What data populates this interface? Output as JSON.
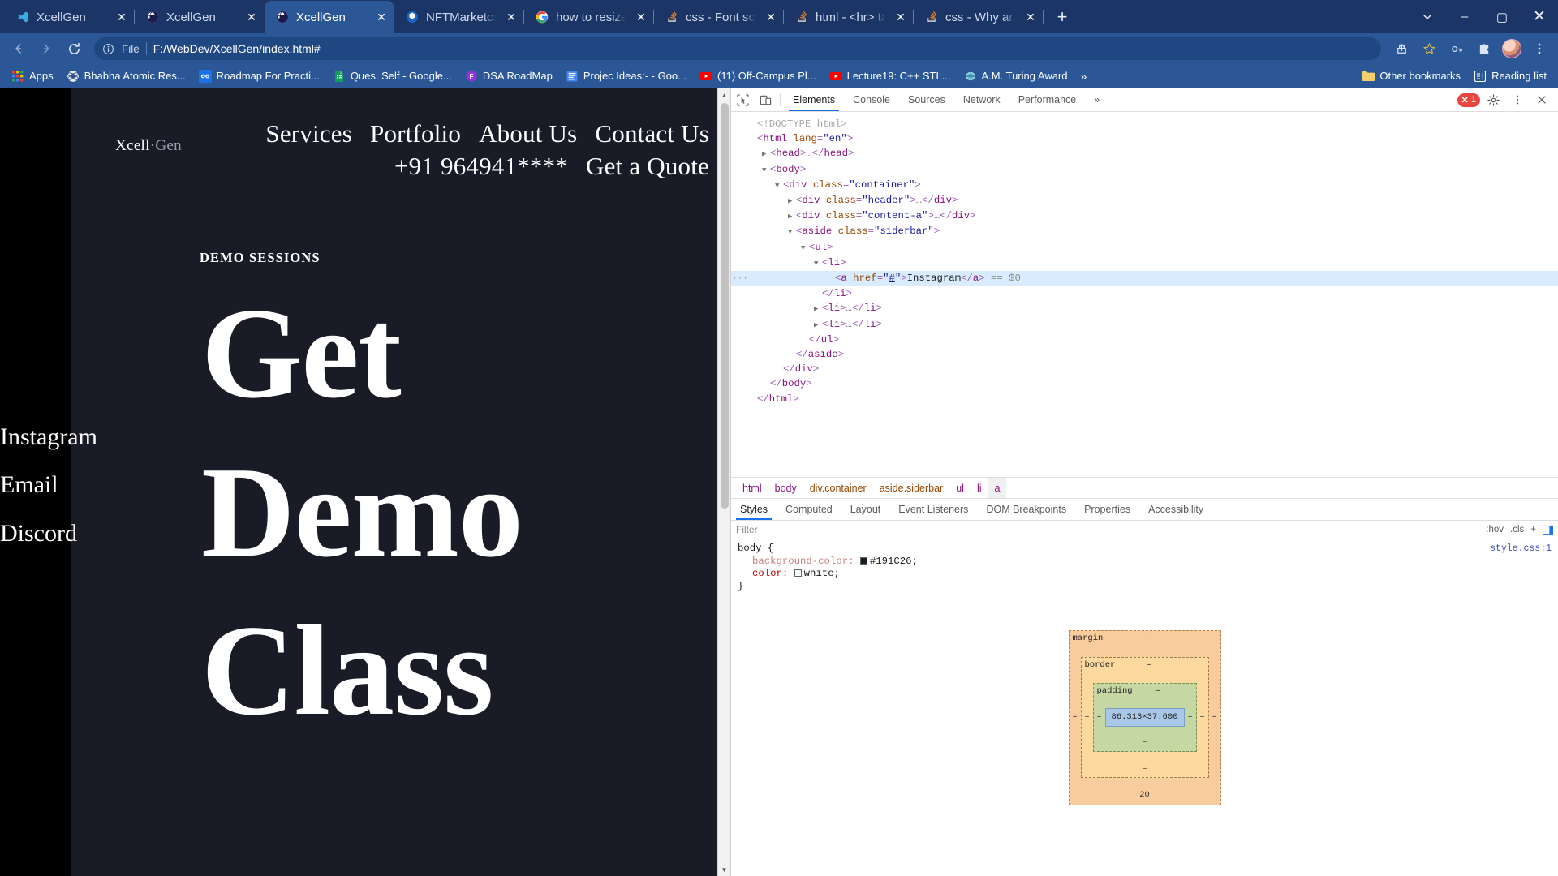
{
  "browser": {
    "tabs": [
      {
        "title": "XcellGen",
        "icon": "vscode-icon",
        "active": false
      },
      {
        "title": "XcellGen",
        "icon": "globe-icon",
        "active": false
      },
      {
        "title": "XcellGen",
        "icon": "globe-icon",
        "active": true
      },
      {
        "title": "NFTMarketcap.Ai",
        "icon": "nft-icon",
        "active": false
      },
      {
        "title": "how to resize font",
        "icon": "google-icon",
        "active": false
      },
      {
        "title": "css - Font scaling",
        "icon": "stackoverflow-icon",
        "active": false
      },
      {
        "title": "html - <hr> tags :",
        "icon": "stackoverflow-icon",
        "active": false
      },
      {
        "title": "css - Why are half",
        "icon": "stackoverflow-icon",
        "active": false
      }
    ],
    "new_tab_label": "+",
    "tab_close_label": "✕",
    "tab_search_icon": "chevron-down-icon",
    "window_controls": {
      "minimize": "–",
      "maximize": "▢",
      "close": "✕"
    },
    "toolbar": {
      "back": "←",
      "forward": "→",
      "reload": "⟳",
      "scheme_label": "File",
      "url": "F:/WebDev/XcellGen/index.html#",
      "share_icon": "share-icon",
      "star_icon": "star-icon",
      "key_icon": "key-icon",
      "extensions_icon": "puzzle-icon",
      "menu_icon": "kebab-menu-icon"
    },
    "bookmarks": {
      "apps_label": "Apps",
      "items": [
        {
          "label": "Bhabha Atomic Res...",
          "icon": "barc-icon"
        },
        {
          "label": "Roadmap For Practi...",
          "icon": "infinity-icon"
        },
        {
          "label": "Ques. Self - Google...",
          "icon": "sheets-icon"
        },
        {
          "label": "DSA RoadMap",
          "icon": "figma-icon"
        },
        {
          "label": "Projec Ideas:- - Goo...",
          "icon": "docs-icon"
        },
        {
          "label": "(11) Off-Campus Pl...",
          "icon": "youtube-icon"
        },
        {
          "label": "Lecture19: C++ STL...",
          "icon": "youtube-icon"
        },
        {
          "label": "A.M. Turing Award",
          "icon": "wikipedia-icon"
        }
      ],
      "overflow_label": "»",
      "other_bookmarks_label": "Other bookmarks",
      "reading_list_label": "Reading list"
    }
  },
  "webpage": {
    "brand_left": "Xcell",
    "brand_sep": "·",
    "brand_right": "Gen",
    "nav": [
      {
        "label": "Services"
      },
      {
        "label": "Portfolio"
      },
      {
        "label": "About Us"
      },
      {
        "label": "Contact Us"
      },
      {
        "label": "+91 964941****"
      },
      {
        "label": "Get a Quote"
      }
    ],
    "demo_label": "DEMO SESSIONS",
    "hero_lines": [
      "Get",
      "Demo",
      "Class"
    ],
    "sidebar_links": [
      "Instagram",
      "Email",
      "Discord"
    ],
    "background_color": "#191C26"
  },
  "devtools": {
    "inspect_icon": "inspect-cursor-icon",
    "device_icon": "device-toggle-icon",
    "tabs": [
      {
        "label": "Elements",
        "active": true
      },
      {
        "label": "Console",
        "active": false
      },
      {
        "label": "Sources",
        "active": false
      },
      {
        "label": "Network",
        "active": false
      },
      {
        "label": "Performance",
        "active": false
      }
    ],
    "more_tabs_label": "»",
    "error_count": "1",
    "error_icon": "error-circle-icon",
    "settings_icon": "gear-icon",
    "dots_icon": "kebab-menu-icon",
    "close_icon": "close-icon",
    "dom": [
      {
        "indent": 0,
        "tri": "",
        "tokens": [
          {
            "t": "doctype",
            "v": "<!DOCTYPE html>"
          }
        ]
      },
      {
        "indent": 0,
        "tri": "",
        "tokens": [
          {
            "t": "punct",
            "v": "<"
          },
          {
            "t": "tag",
            "v": "html"
          },
          {
            "t": "sp",
            "v": " "
          },
          {
            "t": "attr",
            "v": "lang"
          },
          {
            "t": "punct",
            "v": "="
          },
          {
            "t": "val",
            "v": "\"en\""
          },
          {
            "t": "punct",
            "v": ">"
          }
        ]
      },
      {
        "indent": 1,
        "tri": "▶",
        "tokens": [
          {
            "t": "punct",
            "v": "<"
          },
          {
            "t": "tag",
            "v": "head"
          },
          {
            "t": "punct",
            "v": ">"
          },
          {
            "t": "ellip",
            "v": "…"
          },
          {
            "t": "punct",
            "v": "</"
          },
          {
            "t": "tag",
            "v": "head"
          },
          {
            "t": "punct",
            "v": ">"
          }
        ]
      },
      {
        "indent": 1,
        "tri": "▼",
        "tokens": [
          {
            "t": "punct",
            "v": "<"
          },
          {
            "t": "tag",
            "v": "body"
          },
          {
            "t": "punct",
            "v": ">"
          }
        ]
      },
      {
        "indent": 2,
        "tri": "▼",
        "tokens": [
          {
            "t": "punct",
            "v": "<"
          },
          {
            "t": "tag",
            "v": "div"
          },
          {
            "t": "sp",
            "v": " "
          },
          {
            "t": "attr",
            "v": "class"
          },
          {
            "t": "punct",
            "v": "="
          },
          {
            "t": "val",
            "v": "\"container\""
          },
          {
            "t": "punct",
            "v": ">"
          }
        ]
      },
      {
        "indent": 3,
        "tri": "▶",
        "tokens": [
          {
            "t": "punct",
            "v": "<"
          },
          {
            "t": "tag",
            "v": "div"
          },
          {
            "t": "sp",
            "v": " "
          },
          {
            "t": "attr",
            "v": "class"
          },
          {
            "t": "punct",
            "v": "="
          },
          {
            "t": "val",
            "v": "\"header\""
          },
          {
            "t": "punct",
            "v": ">"
          },
          {
            "t": "ellip",
            "v": "…"
          },
          {
            "t": "punct",
            "v": "</"
          },
          {
            "t": "tag",
            "v": "div"
          },
          {
            "t": "punct",
            "v": ">"
          }
        ]
      },
      {
        "indent": 3,
        "tri": "▶",
        "tokens": [
          {
            "t": "punct",
            "v": "<"
          },
          {
            "t": "tag",
            "v": "div"
          },
          {
            "t": "sp",
            "v": " "
          },
          {
            "t": "attr",
            "v": "class"
          },
          {
            "t": "punct",
            "v": "="
          },
          {
            "t": "val",
            "v": "\"content-a\""
          },
          {
            "t": "punct",
            "v": ">"
          },
          {
            "t": "ellip",
            "v": "…"
          },
          {
            "t": "punct",
            "v": "</"
          },
          {
            "t": "tag",
            "v": "div"
          },
          {
            "t": "punct",
            "v": ">"
          }
        ]
      },
      {
        "indent": 3,
        "tri": "▼",
        "tokens": [
          {
            "t": "punct",
            "v": "<"
          },
          {
            "t": "tag",
            "v": "aside"
          },
          {
            "t": "sp",
            "v": " "
          },
          {
            "t": "attr",
            "v": "class"
          },
          {
            "t": "punct",
            "v": "="
          },
          {
            "t": "val",
            "v": "\"siderbar\""
          },
          {
            "t": "punct",
            "v": ">"
          }
        ]
      },
      {
        "indent": 4,
        "tri": "▼",
        "tokens": [
          {
            "t": "punct",
            "v": "<"
          },
          {
            "t": "tag",
            "v": "ul"
          },
          {
            "t": "punct",
            "v": ">"
          }
        ]
      },
      {
        "indent": 5,
        "tri": "▼",
        "tokens": [
          {
            "t": "punct",
            "v": "<"
          },
          {
            "t": "tag",
            "v": "li"
          },
          {
            "t": "punct",
            "v": ">"
          }
        ]
      },
      {
        "indent": 6,
        "tri": "",
        "selected": true,
        "gutter": "···",
        "tokens": [
          {
            "t": "punct",
            "v": "<"
          },
          {
            "t": "tag",
            "v": "a"
          },
          {
            "t": "sp",
            "v": " "
          },
          {
            "t": "attr",
            "v": "href"
          },
          {
            "t": "punct",
            "v": "="
          },
          {
            "t": "val",
            "v": "\""
          },
          {
            "t": "link",
            "v": "#"
          },
          {
            "t": "val",
            "v": "\""
          },
          {
            "t": "punct",
            "v": ">"
          },
          {
            "t": "text",
            "v": "Instagram"
          },
          {
            "t": "punct",
            "v": "</"
          },
          {
            "t": "tag",
            "v": "a"
          },
          {
            "t": "punct",
            "v": ">"
          },
          {
            "t": "sp",
            "v": " "
          },
          {
            "t": "dollar",
            "v": "== $0"
          }
        ]
      },
      {
        "indent": 5,
        "tri": "",
        "tokens": [
          {
            "t": "punct",
            "v": "</"
          },
          {
            "t": "tag",
            "v": "li"
          },
          {
            "t": "punct",
            "v": ">"
          }
        ]
      },
      {
        "indent": 5,
        "tri": "▶",
        "tokens": [
          {
            "t": "punct",
            "v": "<"
          },
          {
            "t": "tag",
            "v": "li"
          },
          {
            "t": "punct",
            "v": ">"
          },
          {
            "t": "ellip",
            "v": "…"
          },
          {
            "t": "punct",
            "v": "</"
          },
          {
            "t": "tag",
            "v": "li"
          },
          {
            "t": "punct",
            "v": ">"
          }
        ]
      },
      {
        "indent": 5,
        "tri": "▶",
        "tokens": [
          {
            "t": "punct",
            "v": "<"
          },
          {
            "t": "tag",
            "v": "li"
          },
          {
            "t": "punct",
            "v": ">"
          },
          {
            "t": "ellip",
            "v": "…"
          },
          {
            "t": "punct",
            "v": "</"
          },
          {
            "t": "tag",
            "v": "li"
          },
          {
            "t": "punct",
            "v": ">"
          }
        ]
      },
      {
        "indent": 4,
        "tri": "",
        "tokens": [
          {
            "t": "punct",
            "v": "</"
          },
          {
            "t": "tag",
            "v": "ul"
          },
          {
            "t": "punct",
            "v": ">"
          }
        ]
      },
      {
        "indent": 3,
        "tri": "",
        "tokens": [
          {
            "t": "punct",
            "v": "</"
          },
          {
            "t": "tag",
            "v": "aside"
          },
          {
            "t": "punct",
            "v": ">"
          }
        ]
      },
      {
        "indent": 2,
        "tri": "",
        "tokens": [
          {
            "t": "punct",
            "v": "</"
          },
          {
            "t": "tag",
            "v": "div"
          },
          {
            "t": "punct",
            "v": ">"
          }
        ]
      },
      {
        "indent": 1,
        "tri": "",
        "tokens": [
          {
            "t": "punct",
            "v": "</"
          },
          {
            "t": "tag",
            "v": "body"
          },
          {
            "t": "punct",
            "v": ">"
          }
        ]
      },
      {
        "indent": 0,
        "tri": "",
        "tokens": [
          {
            "t": "punct",
            "v": "</"
          },
          {
            "t": "tag",
            "v": "html"
          },
          {
            "t": "punct",
            "v": ">"
          }
        ]
      }
    ],
    "breadcrumbs": [
      {
        "label": "html",
        "type": "tag",
        "active": false
      },
      {
        "label": "body",
        "type": "tag",
        "active": false
      },
      {
        "label": "div.container",
        "type": "cls",
        "active": false
      },
      {
        "label": "aside.siderbar",
        "type": "cls",
        "active": false
      },
      {
        "label": "ul",
        "type": "tag",
        "active": false
      },
      {
        "label": "li",
        "type": "tag",
        "active": false
      },
      {
        "label": "a",
        "type": "tag",
        "active": true
      }
    ],
    "subtabs": [
      {
        "label": "Styles",
        "active": true
      },
      {
        "label": "Computed",
        "active": false
      },
      {
        "label": "Layout",
        "active": false
      },
      {
        "label": "Event Listeners",
        "active": false
      },
      {
        "label": "DOM Breakpoints",
        "active": false
      },
      {
        "label": "Properties",
        "active": false
      },
      {
        "label": "Accessibility",
        "active": false
      }
    ],
    "filter_placeholder": "Filter",
    "hov_label": ":hov",
    "cls_label": ".cls",
    "plus_label": "+",
    "panel_icon": "new-style-rule-icon",
    "style_rule": {
      "selector": "body {",
      "source": "style.css:1",
      "close_brace": "}",
      "declarations": [
        {
          "prop": "background-color",
          "value": "#191C26;",
          "swatch": "#191C26",
          "struck": false
        },
        {
          "prop": "color",
          "value": "white;",
          "swatch": "#ffffff",
          "struck": true
        }
      ]
    },
    "box_model": {
      "margin_label": "margin",
      "border_label": "border",
      "padding_label": "padding",
      "content_size": "86.313×37.600",
      "dash": "–",
      "margin_bottom": "20"
    }
  }
}
